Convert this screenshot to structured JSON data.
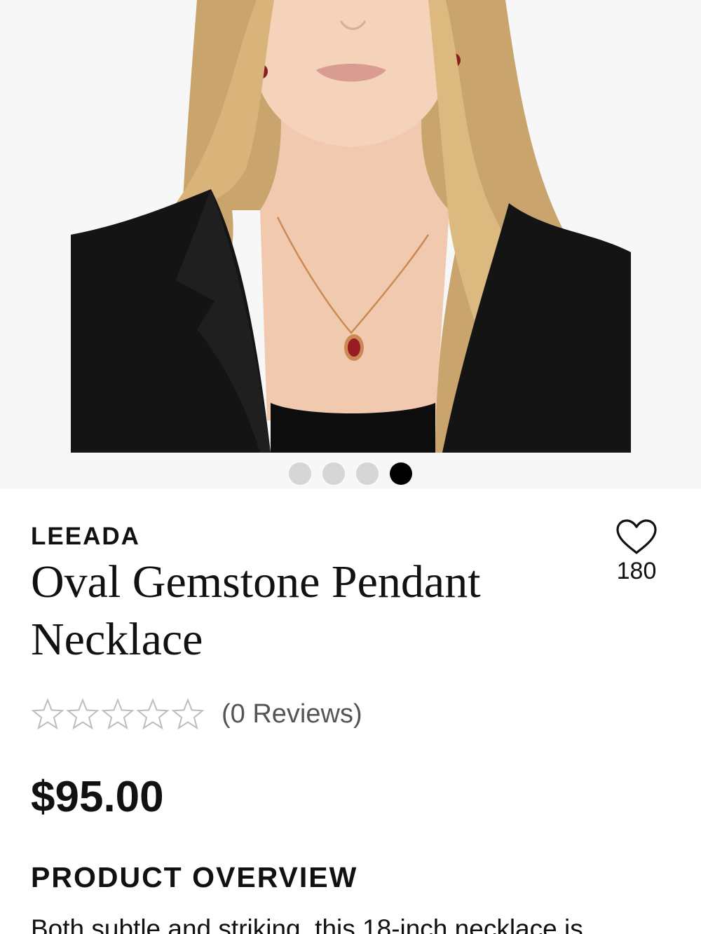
{
  "gallery": {
    "image_alt": "Model wearing oval gemstone pendant necklace",
    "slide_count": 4,
    "active_slide": 4
  },
  "product": {
    "brand": "LEEADA",
    "title": "Oval Gemstone Pendant Necklace",
    "favorites_count": "180",
    "rating": 0,
    "rating_max": 5,
    "reviews_label": "(0 Reviews)",
    "price": "$95.00"
  },
  "overview": {
    "heading": "PRODUCT OVERVIEW",
    "text": "Both subtle and striking, this 18-inch necklace is"
  },
  "icons": {
    "favorite": "heart-outline-icon",
    "rating_star": "star-outline-icon"
  },
  "colors": {
    "active_dot": "#000000",
    "inactive_dot": "#d6d6d6",
    "gallery_bg": "#f7f7f7",
    "text": "#111111",
    "muted_text": "#555555"
  }
}
